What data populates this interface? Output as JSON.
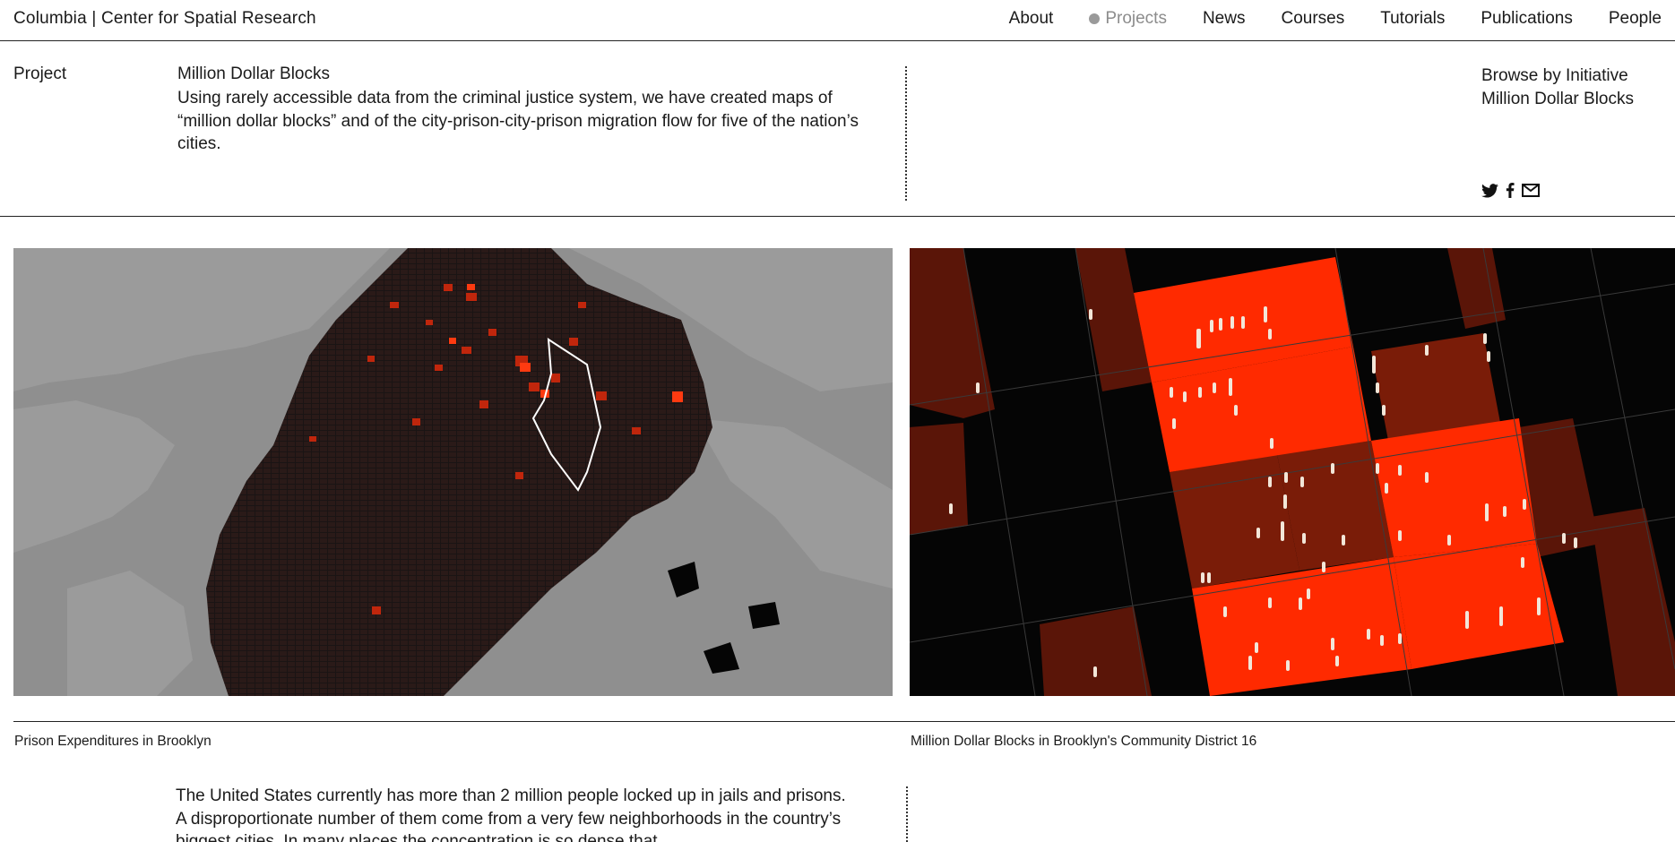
{
  "header": {
    "site_title": "Columbia | Center for Spatial Research",
    "nav": [
      "About",
      "Projects",
      "News",
      "Courses",
      "Tutorials",
      "Publications",
      "People"
    ],
    "active_nav": "Projects"
  },
  "project": {
    "label": "Project",
    "title": "Million Dollar Blocks",
    "description": "Using rarely accessible data from the criminal justice system, we have created maps of “million dollar blocks” and of the city-prison-city-prison migration flow for five of the nation’s cities."
  },
  "browse": {
    "heading": "Browse by Initiative",
    "initiative": "Million Dollar Blocks"
  },
  "social": {
    "icons": [
      "twitter-icon",
      "facebook-icon",
      "mail-icon"
    ]
  },
  "images": {
    "left_caption": "Prison Expenditures in Brooklyn",
    "right_caption": "Million Dollar Blocks in Brooklyn's Community District 16"
  },
  "body": {
    "text": "The United States currently has more than 2 million people locked up in jails and prisons. A disproportionate number of them come from a very few neighborhoods in the country’s biggest cities. In many places the concentration is so dense that"
  },
  "colors": {
    "accent_red": "#ff2a00",
    "dark_red": "#6a1608",
    "map_gray": "#8f8f8f"
  }
}
